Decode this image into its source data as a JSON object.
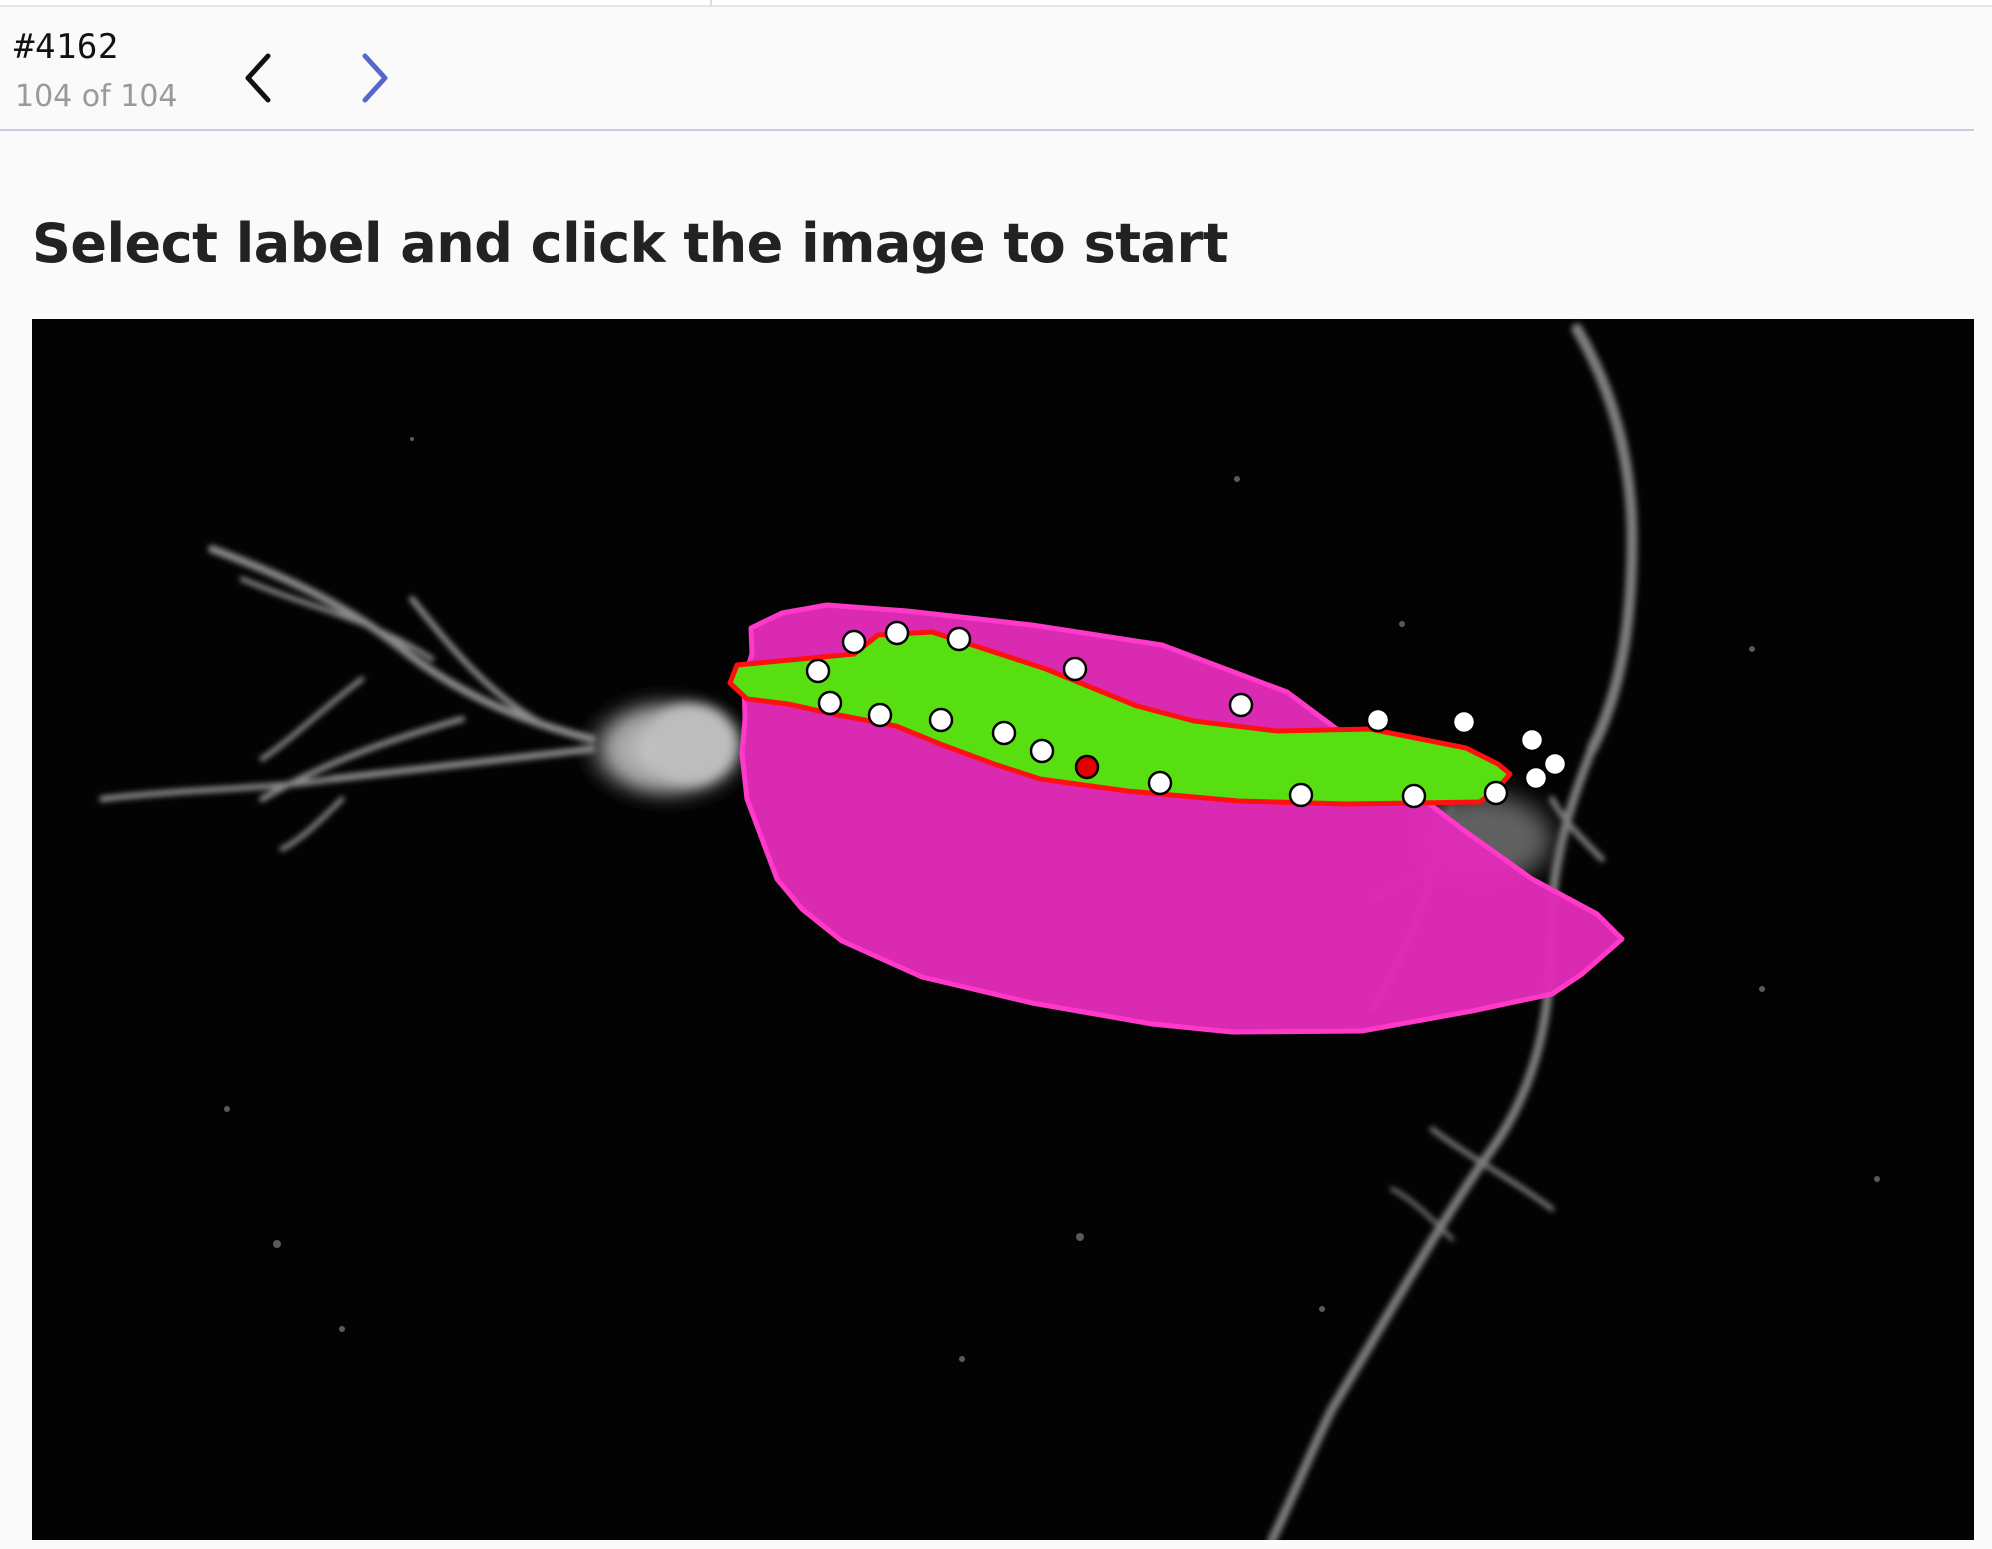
{
  "header": {
    "task_id": "#4162",
    "task_counter": "104 of 104",
    "prev_icon": "chevron-left-icon",
    "next_icon": "chevron-right-icon",
    "prev_color": "#111111",
    "next_color": "#5567c9"
  },
  "main": {
    "instruction": "Select label and click the image to start"
  },
  "annotation": {
    "outer_region_color": "#e22bb8",
    "outer_region_stroke": "#ff3ac9",
    "inner_region_color": "#58df12",
    "inner_region_stroke": "#ff1010",
    "vertex_color": "#ffffff",
    "active_vertex_color": "#e00000"
  }
}
